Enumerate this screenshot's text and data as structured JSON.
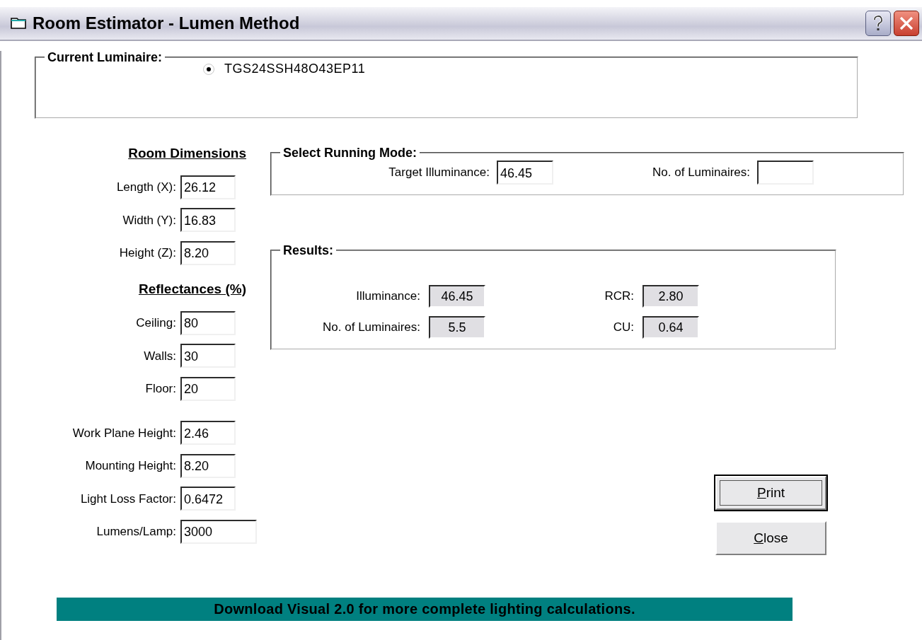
{
  "window": {
    "title": "Room Estimator - Lumen Method"
  },
  "current_luminaire": {
    "legend": "Current Luminaire:",
    "options": [
      {
        "label": "TGS24SSH48O43EP11",
        "selected": true
      }
    ]
  },
  "room_dimensions": {
    "heading": "Room Dimensions",
    "fields": [
      {
        "label": "Length (X):",
        "value": "26.12"
      },
      {
        "label": "Width (Y):",
        "value": "16.83"
      },
      {
        "label": "Height (Z):",
        "value": "8.20"
      }
    ]
  },
  "reflectances": {
    "heading": "Reflectances (%)",
    "fields": [
      {
        "label": "Ceiling:",
        "value": "80"
      },
      {
        "label": "Walls:",
        "value": "30"
      },
      {
        "label": "Floor:",
        "value": "20"
      }
    ]
  },
  "other_fields": [
    {
      "label": "Work Plane Height:",
      "value": "2.46",
      "kind": "normal"
    },
    {
      "label": "Mounting Height:",
      "value": "8.20",
      "kind": "normal"
    },
    {
      "label": "Light Loss Factor:",
      "value": "0.6472",
      "kind": "normal"
    },
    {
      "label": "Lumens/Lamp:",
      "value": "3000",
      "kind": "wide"
    }
  ],
  "running_mode": {
    "legend": "Select Running Mode:",
    "fields": [
      {
        "label": "Target Illuminance:",
        "value": "46.45"
      },
      {
        "label": "No. of Luminaires:"
      }
    ]
  },
  "results": {
    "legend": "Results:",
    "fields": [
      {
        "label": "Illuminance:",
        "value": "46.45"
      },
      {
        "label": "RCR:",
        "value": "2.80"
      },
      {
        "label": "No. of Luminaires:",
        "value": "5.5"
      },
      {
        "label": "CU:",
        "value": "0.64"
      }
    ]
  },
  "buttons": [
    {
      "label": "Print",
      "default": true,
      "underline_first": true
    },
    {
      "label": "Close",
      "default": false,
      "underline_first": true
    }
  ],
  "banner": "Download Visual 2.0 for more complete lighting calculations."
}
